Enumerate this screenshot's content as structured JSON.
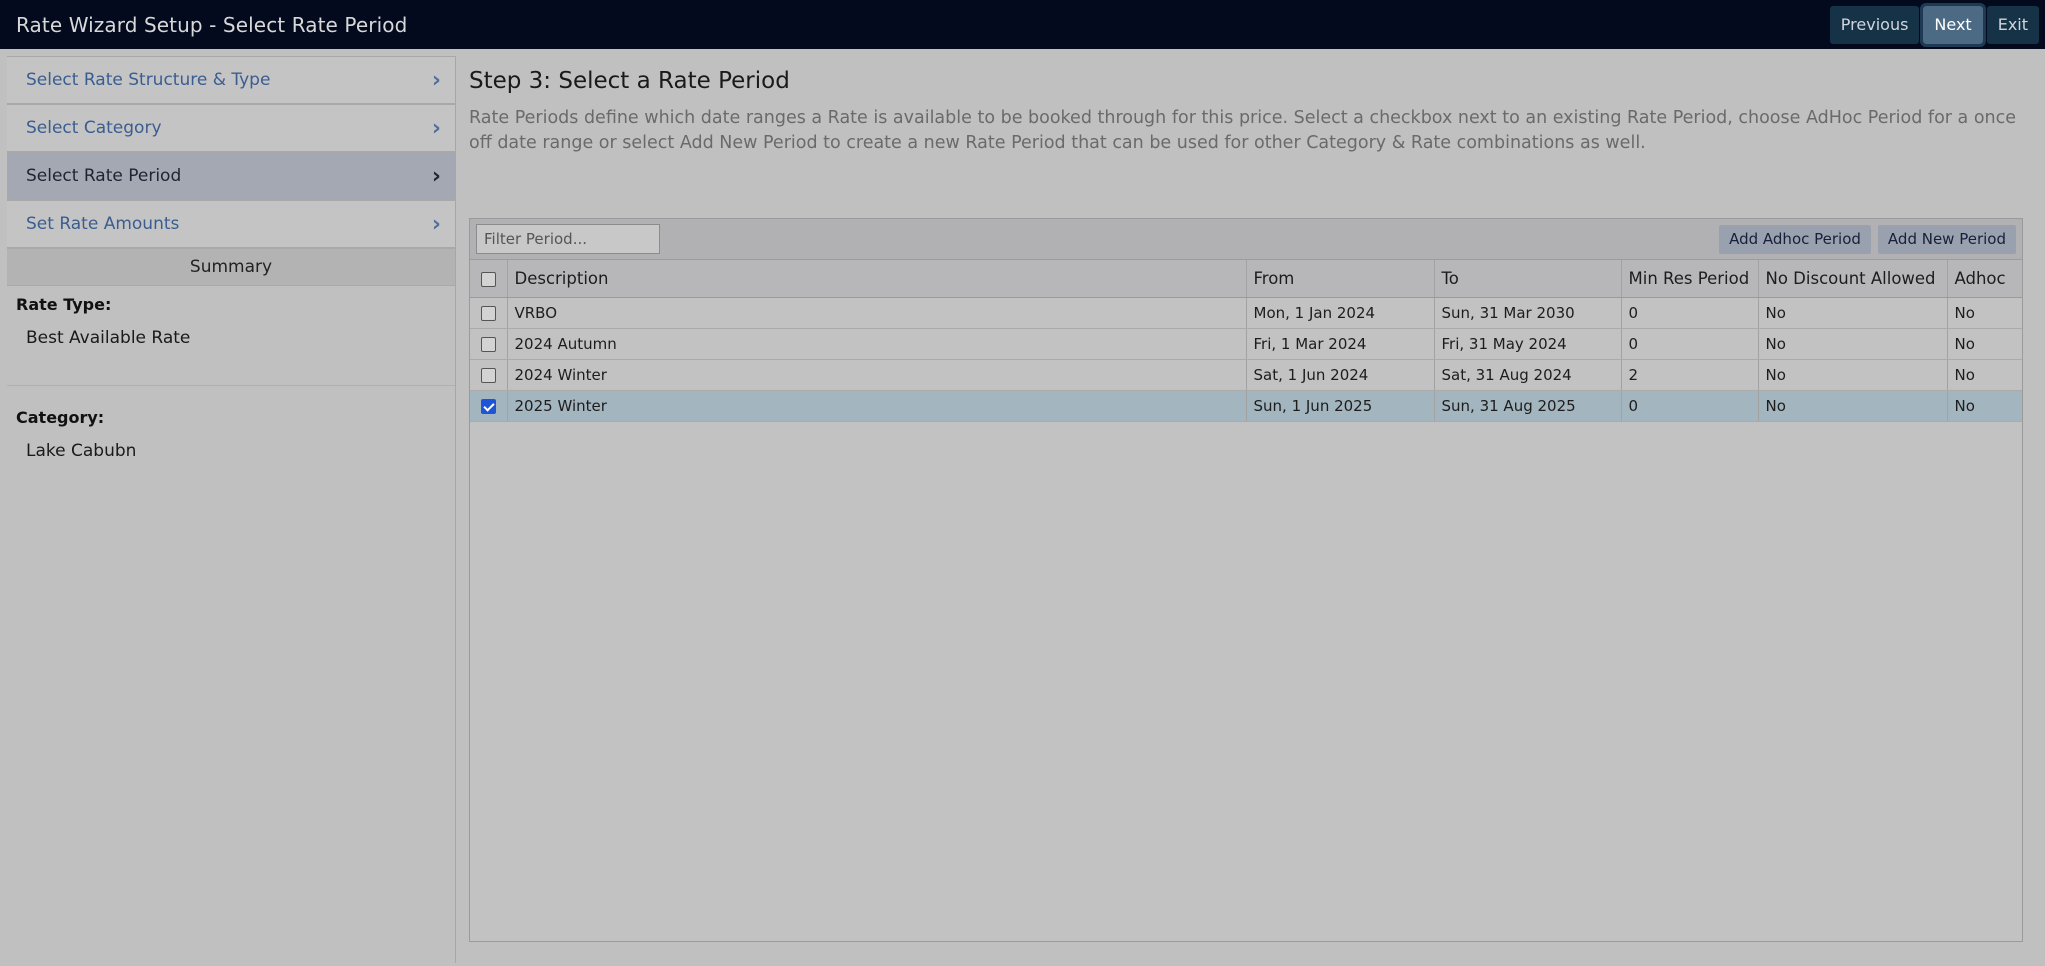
{
  "header": {
    "title": "Rate Wizard Setup - Select Rate Period",
    "buttons": {
      "previous": "Previous",
      "next": "Next",
      "exit": "Exit"
    }
  },
  "sidebar": {
    "steps": [
      {
        "label": "Select Rate Structure & Type",
        "active": false
      },
      {
        "label": "Select Category",
        "active": false
      },
      {
        "label": "Select Rate Period",
        "active": true
      },
      {
        "label": "Set Rate Amounts",
        "active": false
      }
    ],
    "summary": {
      "heading": "Summary",
      "rate_type_label": "Rate Type:",
      "rate_type_value": "Best Available Rate",
      "category_label": "Category:",
      "category_value": "Lake Cabubn"
    }
  },
  "main": {
    "title": "Step 3: Select a Rate Period",
    "description": "Rate Periods define which date ranges a Rate is available to be booked through for this price. Select a checkbox next to an existing Rate Period, choose AdHoc Period for a once off date range or select Add New Period to create a new Rate Period that can be used for other Category & Rate combinations as well.",
    "filter_placeholder": "Filter Period...",
    "add_adhoc_label": "Add Adhoc Period",
    "add_new_label": "Add New Period",
    "table": {
      "columns": [
        "Description",
        "From",
        "To",
        "Min Res Period",
        "No Discount Allowed",
        "Adhoc"
      ],
      "rows": [
        {
          "description": "VRBO",
          "from": "Mon, 1 Jan 2024",
          "to": "Sun, 31 Mar 2030",
          "min_res": "0",
          "no_discount": "No",
          "adhoc": "No",
          "checked": false
        },
        {
          "description": "2024 Autumn",
          "from": "Fri, 1 Mar 2024",
          "to": "Fri, 31 May 2024",
          "min_res": "0",
          "no_discount": "No",
          "adhoc": "No",
          "checked": false
        },
        {
          "description": "2024 Winter",
          "from": "Sat, 1 Jun 2024",
          "to": "Sat, 31 Aug 2024",
          "min_res": "2",
          "no_discount": "No",
          "adhoc": "No",
          "checked": false
        },
        {
          "description": "2025 Winter",
          "from": "Sun, 1 Jun 2025",
          "to": "Sun, 31 Aug 2025",
          "min_res": "0",
          "no_discount": "No",
          "adhoc": "No",
          "checked": true
        }
      ]
    }
  },
  "colors": {
    "header_bg": "#030a1e",
    "accent_link": "#3a5d91",
    "selected_row": "#a3b5bf",
    "checkbox_checked": "#1e55d8"
  }
}
